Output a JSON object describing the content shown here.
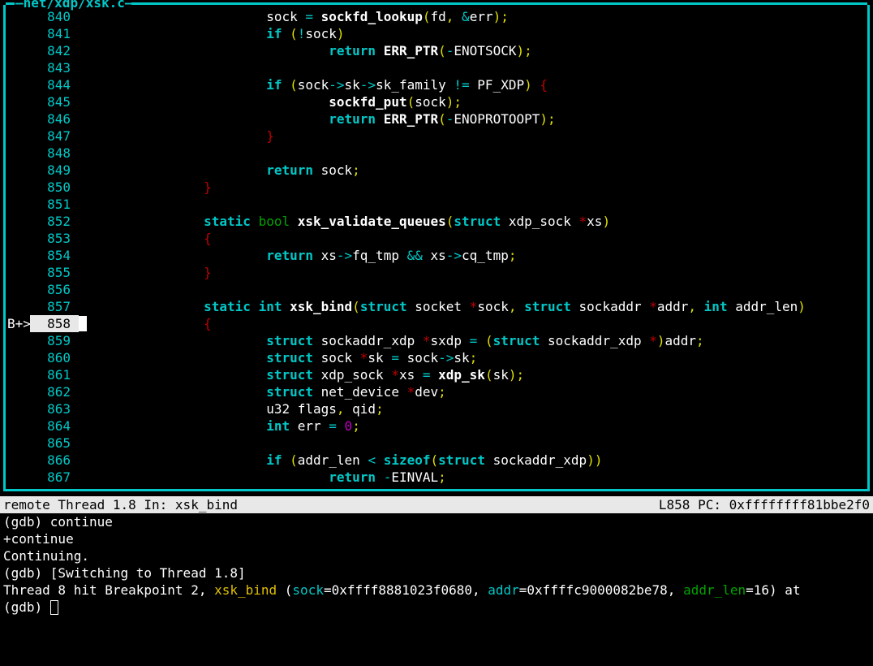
{
  "title": "net/xdp/xsk.c",
  "status": {
    "left": "remote Thread 1.8 In: xsk_bind",
    "right": "L858   PC: 0xffffffff81bbe2f0"
  },
  "breakpoint": {
    "marker": "B+>",
    "line": 858
  },
  "src": [
    {
      "n": 840,
      "tokens": [
        [
          "pad",
          "                        "
        ],
        [
          "id",
          "sock "
        ],
        [
          "op",
          "="
        ],
        [
          "id",
          " "
        ],
        [
          "fn",
          "sockfd_lookup"
        ],
        [
          "pn",
          "("
        ],
        [
          "id",
          "fd"
        ],
        [
          "pn",
          ", "
        ],
        [
          "op",
          "&"
        ],
        [
          "id",
          "err"
        ],
        [
          "pn",
          ");"
        ]
      ]
    },
    {
      "n": 841,
      "tokens": [
        [
          "pad",
          "                        "
        ],
        [
          "kw",
          "if"
        ],
        [
          "id",
          " "
        ],
        [
          "pn",
          "("
        ],
        [
          "op",
          "!"
        ],
        [
          "id",
          "sock"
        ],
        [
          "pn",
          ")"
        ]
      ]
    },
    {
      "n": 842,
      "tokens": [
        [
          "pad",
          "                                "
        ],
        [
          "kw",
          "return"
        ],
        [
          "id",
          " "
        ],
        [
          "fn",
          "ERR_PTR"
        ],
        [
          "pn",
          "("
        ],
        [
          "op",
          "-"
        ],
        [
          "id",
          "ENOTSOCK"
        ],
        [
          "pn",
          ");"
        ]
      ]
    },
    {
      "n": 843,
      "tokens": []
    },
    {
      "n": 844,
      "tokens": [
        [
          "pad",
          "                        "
        ],
        [
          "kw",
          "if"
        ],
        [
          "id",
          " "
        ],
        [
          "pn",
          "("
        ],
        [
          "id",
          "sock"
        ],
        [
          "op",
          "->"
        ],
        [
          "id",
          "sk"
        ],
        [
          "op",
          "->"
        ],
        [
          "id",
          "sk_family "
        ],
        [
          "op",
          "!="
        ],
        [
          "id",
          " PF_XDP"
        ],
        [
          "pn",
          ")"
        ],
        [
          "id",
          " "
        ],
        [
          "br",
          "{"
        ]
      ]
    },
    {
      "n": 845,
      "tokens": [
        [
          "pad",
          "                                "
        ],
        [
          "fn",
          "sockfd_put"
        ],
        [
          "pn",
          "("
        ],
        [
          "id",
          "sock"
        ],
        [
          "pn",
          ");"
        ]
      ]
    },
    {
      "n": 846,
      "tokens": [
        [
          "pad",
          "                                "
        ],
        [
          "kw",
          "return"
        ],
        [
          "id",
          " "
        ],
        [
          "fn",
          "ERR_PTR"
        ],
        [
          "pn",
          "("
        ],
        [
          "op",
          "-"
        ],
        [
          "id",
          "ENOPROTOOPT"
        ],
        [
          "pn",
          ");"
        ]
      ]
    },
    {
      "n": 847,
      "tokens": [
        [
          "pad",
          "                        "
        ],
        [
          "br",
          "}"
        ]
      ]
    },
    {
      "n": 848,
      "tokens": []
    },
    {
      "n": 849,
      "tokens": [
        [
          "pad",
          "                        "
        ],
        [
          "kw",
          "return"
        ],
        [
          "id",
          " sock"
        ],
        [
          "pn",
          ";"
        ]
      ]
    },
    {
      "n": 850,
      "tokens": [
        [
          "pad",
          "                "
        ],
        [
          "br",
          "}"
        ]
      ]
    },
    {
      "n": 851,
      "tokens": []
    },
    {
      "n": 852,
      "tokens": [
        [
          "pad",
          "                "
        ],
        [
          "kw",
          "static"
        ],
        [
          "id",
          " "
        ],
        [
          "ty",
          "bool"
        ],
        [
          "id",
          " "
        ],
        [
          "fn",
          "xsk_validate_queues"
        ],
        [
          "pn",
          "("
        ],
        [
          "kw",
          "struct"
        ],
        [
          "id",
          " xdp_sock "
        ],
        [
          "star",
          "*"
        ],
        [
          "id",
          "xs"
        ],
        [
          "pn",
          ")"
        ]
      ]
    },
    {
      "n": 853,
      "tokens": [
        [
          "pad",
          "                "
        ],
        [
          "br",
          "{"
        ]
      ]
    },
    {
      "n": 854,
      "tokens": [
        [
          "pad",
          "                        "
        ],
        [
          "kw",
          "return"
        ],
        [
          "id",
          " xs"
        ],
        [
          "op",
          "->"
        ],
        [
          "id",
          "fq_tmp "
        ],
        [
          "op",
          "&&"
        ],
        [
          "id",
          " xs"
        ],
        [
          "op",
          "->"
        ],
        [
          "id",
          "cq_tmp"
        ],
        [
          "pn",
          ";"
        ]
      ]
    },
    {
      "n": 855,
      "tokens": [
        [
          "pad",
          "                "
        ],
        [
          "br",
          "}"
        ]
      ]
    },
    {
      "n": 856,
      "tokens": []
    },
    {
      "n": 857,
      "tokens": [
        [
          "pad",
          "                "
        ],
        [
          "kw",
          "static"
        ],
        [
          "id",
          " "
        ],
        [
          "kw",
          "int"
        ],
        [
          "id",
          " "
        ],
        [
          "fn",
          "xsk_bind"
        ],
        [
          "pn",
          "("
        ],
        [
          "kw",
          "struct"
        ],
        [
          "id",
          " socket "
        ],
        [
          "star",
          "*"
        ],
        [
          "id",
          "sock"
        ],
        [
          "pn",
          ", "
        ],
        [
          "kw",
          "struct"
        ],
        [
          "id",
          " sockaddr "
        ],
        [
          "star",
          "*"
        ],
        [
          "id",
          "addr"
        ],
        [
          "pn",
          ", "
        ],
        [
          "kw",
          "int"
        ],
        [
          "id",
          " addr_len"
        ],
        [
          "pn",
          ")"
        ]
      ]
    },
    {
      "n": 858,
      "tokens": [
        [
          "pad",
          "                "
        ],
        [
          "br",
          "{"
        ]
      ],
      "current": true
    },
    {
      "n": 859,
      "tokens": [
        [
          "pad",
          "                        "
        ],
        [
          "kw",
          "struct"
        ],
        [
          "id",
          " sockaddr_xdp "
        ],
        [
          "star",
          "*"
        ],
        [
          "id",
          "sxdp "
        ],
        [
          "op",
          "="
        ],
        [
          "id",
          " "
        ],
        [
          "pn",
          "("
        ],
        [
          "kw",
          "struct"
        ],
        [
          "id",
          " sockaddr_xdp "
        ],
        [
          "star",
          "*"
        ],
        [
          "pn",
          ")"
        ],
        [
          "id",
          "addr"
        ],
        [
          "pn",
          ";"
        ]
      ]
    },
    {
      "n": 860,
      "tokens": [
        [
          "pad",
          "                        "
        ],
        [
          "kw",
          "struct"
        ],
        [
          "id",
          " sock "
        ],
        [
          "star",
          "*"
        ],
        [
          "id",
          "sk "
        ],
        [
          "op",
          "="
        ],
        [
          "id",
          " sock"
        ],
        [
          "op",
          "->"
        ],
        [
          "id",
          "sk"
        ],
        [
          "pn",
          ";"
        ]
      ]
    },
    {
      "n": 861,
      "tokens": [
        [
          "pad",
          "                        "
        ],
        [
          "kw",
          "struct"
        ],
        [
          "id",
          " xdp_sock "
        ],
        [
          "star",
          "*"
        ],
        [
          "id",
          "xs "
        ],
        [
          "op",
          "="
        ],
        [
          "id",
          " "
        ],
        [
          "fn",
          "xdp_sk"
        ],
        [
          "pn",
          "("
        ],
        [
          "id",
          "sk"
        ],
        [
          "pn",
          ");"
        ]
      ]
    },
    {
      "n": 862,
      "tokens": [
        [
          "pad",
          "                        "
        ],
        [
          "kw",
          "struct"
        ],
        [
          "id",
          " net_device "
        ],
        [
          "star",
          "*"
        ],
        [
          "id",
          "dev"
        ],
        [
          "pn",
          ";"
        ]
      ]
    },
    {
      "n": 863,
      "tokens": [
        [
          "pad",
          "                        "
        ],
        [
          "id",
          "u32 flags"
        ],
        [
          "pn",
          ", "
        ],
        [
          "id",
          "qid"
        ],
        [
          "pn",
          ";"
        ]
      ]
    },
    {
      "n": 864,
      "tokens": [
        [
          "pad",
          "                        "
        ],
        [
          "kw",
          "int"
        ],
        [
          "id",
          " err "
        ],
        [
          "op",
          "="
        ],
        [
          "id",
          " "
        ],
        [
          "num",
          "0"
        ],
        [
          "pn",
          ";"
        ]
      ]
    },
    {
      "n": 865,
      "tokens": []
    },
    {
      "n": 866,
      "tokens": [
        [
          "pad",
          "                        "
        ],
        [
          "kw",
          "if"
        ],
        [
          "id",
          " "
        ],
        [
          "pn",
          "("
        ],
        [
          "id",
          "addr_len "
        ],
        [
          "op",
          "<"
        ],
        [
          "id",
          " "
        ],
        [
          "kw",
          "sizeof"
        ],
        [
          "pn",
          "("
        ],
        [
          "kw",
          "struct"
        ],
        [
          "id",
          " sockaddr_xdp"
        ],
        [
          "pn",
          "))"
        ]
      ]
    },
    {
      "n": 867,
      "tokens": [
        [
          "pad",
          "                                "
        ],
        [
          "kw",
          "return"
        ],
        [
          "id",
          " "
        ],
        [
          "op",
          "-"
        ],
        [
          "id",
          "EINVAL"
        ],
        [
          "pn",
          ";"
        ]
      ]
    }
  ],
  "console": [
    {
      "segs": [
        [
          "id",
          "(gdb) continue"
        ]
      ]
    },
    {
      "segs": [
        [
          "id",
          "+continue"
        ]
      ]
    },
    {
      "segs": [
        [
          "id",
          "Continuing."
        ]
      ]
    },
    {
      "segs": [
        [
          "id",
          "(gdb) [Switching to Thread 1.8]"
        ]
      ]
    },
    {
      "segs": [
        [
          "id",
          ""
        ]
      ]
    },
    {
      "segs": [
        [
          "id",
          "Thread 8 hit Breakpoint 2, "
        ],
        [
          "yel",
          "xsk_bind"
        ],
        [
          "id",
          " ("
        ],
        [
          "cyan",
          "sock"
        ],
        [
          "id",
          "=0xffff8881023f0680, "
        ],
        [
          "cyan",
          "addr"
        ],
        [
          "id",
          "=0xffffc9000082be78, "
        ],
        [
          "grn",
          "addr_len"
        ],
        [
          "id",
          "=16) at"
        ]
      ]
    },
    {
      "segs": [
        [
          "id",
          "(gdb) "
        ]
      ],
      "cursor": true
    }
  ]
}
